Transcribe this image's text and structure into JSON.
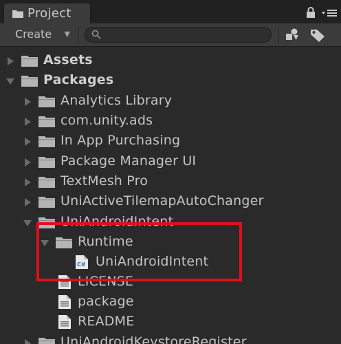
{
  "window": {
    "tab_title": "Project",
    "tab_icon": "folder-icon",
    "lock_icon": "lock-icon",
    "menu_icon": "panel-menu-icon"
  },
  "toolbar": {
    "create_label": "Create",
    "search_placeholder": "",
    "filter_by_type_icon": "filter-by-type-icon",
    "filter_by_label_icon": "tag-icon"
  },
  "tree": [
    {
      "name": "Assets",
      "kind": "folder",
      "bold": true,
      "expanded": false
    },
    {
      "name": "Packages",
      "kind": "folder",
      "bold": true,
      "expanded": true
    },
    {
      "name": "Analytics Library",
      "kind": "folder",
      "expanded": false
    },
    {
      "name": "com.unity.ads",
      "kind": "folder",
      "expanded": false
    },
    {
      "name": "In App Purchasing",
      "kind": "folder",
      "expanded": false
    },
    {
      "name": "Package Manager UI",
      "kind": "folder",
      "expanded": false
    },
    {
      "name": "TextMesh Pro",
      "kind": "folder",
      "expanded": false
    },
    {
      "name": "UniActiveTilemapAutoChanger",
      "kind": "folder",
      "expanded": false
    },
    {
      "name": "UniAndroidIntent",
      "kind": "folder",
      "expanded": true
    },
    {
      "name": "Runtime",
      "kind": "folder",
      "expanded": true
    },
    {
      "name": "UniAndroidIntent",
      "kind": "csharp-script"
    },
    {
      "name": "LICENSE",
      "kind": "text-file"
    },
    {
      "name": "package",
      "kind": "text-file"
    },
    {
      "name": "README",
      "kind": "text-file"
    },
    {
      "name": "UniAndroidKeystoreRegister",
      "kind": "folder",
      "expanded": false
    }
  ],
  "annotation": {
    "color": "#e0101a"
  }
}
